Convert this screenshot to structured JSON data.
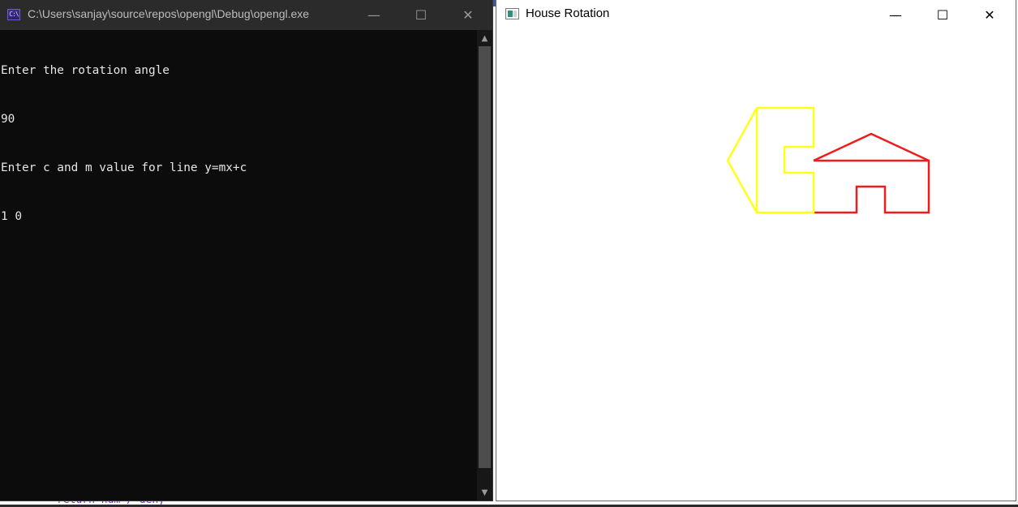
{
  "console_window": {
    "title": "C:\\Users\\sanjay\\source\\repos\\opengl\\Debug\\opengl.exe",
    "icon_text": "C:\\",
    "output_lines": [
      "Enter the rotation angle",
      "90",
      "Enter c and m value for line y=mx+c",
      "1 0"
    ],
    "controls": {
      "minimize": "—",
      "maximize": "☐",
      "close": "✕"
    },
    "scrollbar": {
      "up": "▲",
      "down": "▼"
    }
  },
  "gl_window": {
    "title": "House Rotation",
    "controls": {
      "minimize": "—",
      "maximize": "☐",
      "close": "✕"
    },
    "colors": {
      "original_house": "#ee1c1c",
      "transformed_house": "#ffff1a",
      "background": "#ffffff"
    }
  },
  "background_editor": {
    "code_fragment": "return num / den;"
  }
}
